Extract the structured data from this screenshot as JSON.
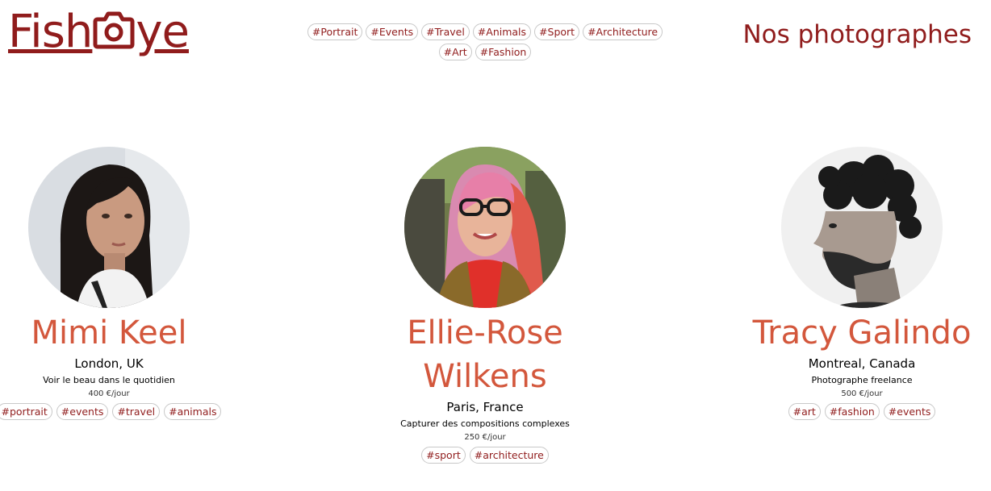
{
  "brand": {
    "logo_text_left": "Fish",
    "logo_text_right": "ye",
    "color": "#901C1C"
  },
  "nav": {
    "tags": [
      "#Portrait",
      "#Events",
      "#Travel",
      "#Animals",
      "#Sport",
      "#Architecture",
      "#Art",
      "#Fashion"
    ]
  },
  "page_title": "Nos photographes",
  "accent_color": "#D3573C",
  "photographers": [
    {
      "name": "Mimi Keel",
      "location": "London, UK",
      "tagline": "Voir le beau dans le quotidien",
      "price": "400 €/jour",
      "tags": [
        "#portrait",
        "#events",
        "#travel",
        "#animals"
      ],
      "avatar_icon": "portrait-photo-woman-dark-hair"
    },
    {
      "name": "Ellie-Rose Wilkens",
      "location": "Paris, France",
      "tagline": "Capturer des compositions complexes",
      "price": "250 €/jour",
      "tags": [
        "#sport",
        "#architecture"
      ],
      "avatar_icon": "portrait-photo-woman-pink-hair-glasses"
    },
    {
      "name": "Tracy Galindo",
      "location": "Montreal, Canada",
      "tagline": "Photographe freelance",
      "price": "500 €/jour",
      "tags": [
        "#art",
        "#fashion",
        "#events"
      ],
      "avatar_icon": "portrait-photo-man-curly-hair-beard"
    }
  ]
}
